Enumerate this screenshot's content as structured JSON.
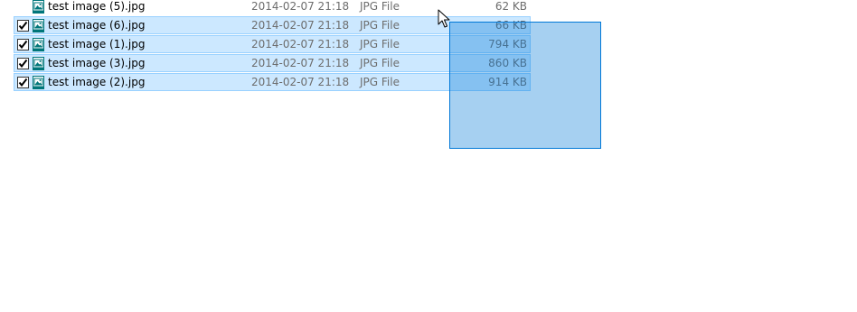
{
  "files": [
    {
      "name": "test image (5).jpg",
      "date": "2014-02-07 21:18",
      "type": "JPG File",
      "size": "62 KB",
      "selected": false,
      "checked": false,
      "icon": "image-file-icon"
    },
    {
      "name": "test image (6).jpg",
      "date": "2014-02-07 21:18",
      "type": "JPG File",
      "size": "66 KB",
      "selected": true,
      "checked": true,
      "icon": "image-file-icon"
    },
    {
      "name": "test image (1).jpg",
      "date": "2014-02-07 21:18",
      "type": "JPG File",
      "size": "794 KB",
      "selected": true,
      "checked": true,
      "icon": "image-file-icon"
    },
    {
      "name": "test image (3).jpg",
      "date": "2014-02-07 21:18",
      "type": "JPG File",
      "size": "860 KB",
      "selected": true,
      "checked": true,
      "icon": "image-file-icon"
    },
    {
      "name": "test image (2).jpg",
      "date": "2014-02-07 21:18",
      "type": "JPG File",
      "size": "914 KB",
      "selected": true,
      "checked": true,
      "icon": "image-file-icon"
    }
  ],
  "colors": {
    "selection_fill": "#cce8ff",
    "selection_border": "#99d1ff",
    "marquee_fill": "#0078d7",
    "icon_teal": "#00767a"
  },
  "cursor": "arrow-cursor-icon"
}
